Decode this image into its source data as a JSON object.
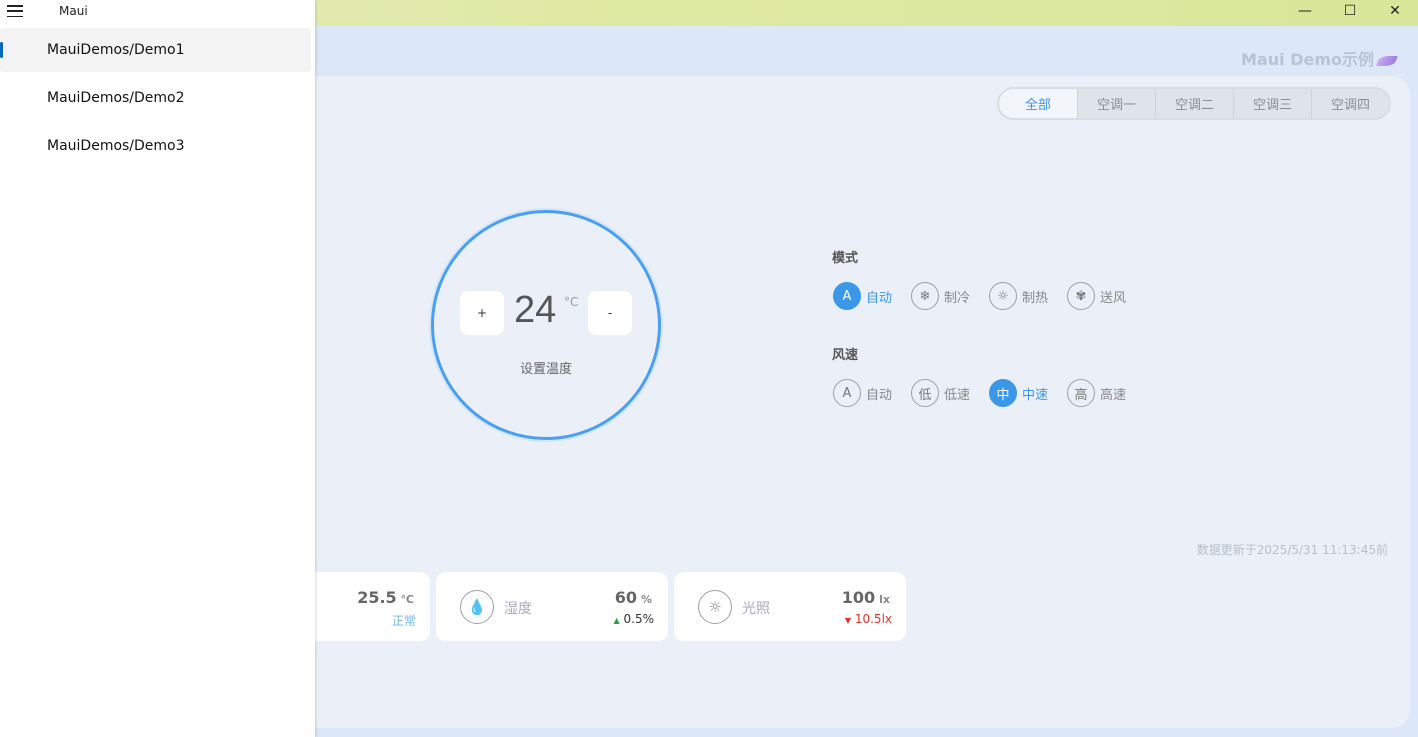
{
  "window": {
    "app_title": "Maui",
    "minimize": "—",
    "maximize": "☐",
    "close": "✕"
  },
  "nav": {
    "items": [
      {
        "label": "MauiDemos/Demo1",
        "selected": true
      },
      {
        "label": "MauiDemos/Demo2",
        "selected": false
      },
      {
        "label": "MauiDemos/Demo3",
        "selected": false
      }
    ]
  },
  "header": {
    "brand": "Maui Demo示例"
  },
  "tabs": [
    "全部",
    "空调一",
    "空调二",
    "空调三",
    "空调四"
  ],
  "thermostat": {
    "plus": "+",
    "minus": "-",
    "temperature": "24",
    "unit": "°C",
    "label": "设置温度"
  },
  "mode": {
    "title": "模式",
    "options": [
      {
        "icon": "A",
        "label": "自动",
        "active": true
      },
      {
        "icon": "❄",
        "label": "制冷",
        "active": false
      },
      {
        "icon": "☼",
        "label": "制热",
        "active": false
      },
      {
        "icon": "✾",
        "label": "送风",
        "active": false
      }
    ]
  },
  "fan": {
    "title": "风速",
    "options": [
      {
        "icon": "A",
        "label": "自动",
        "active": false
      },
      {
        "icon": "低",
        "label": "低速",
        "active": false
      },
      {
        "icon": "中",
        "label": "中速",
        "active": true
      },
      {
        "icon": "高",
        "label": "高速",
        "active": false
      }
    ]
  },
  "update_time": "数据更新于2025/5/31 11:13:45前",
  "sensors": [
    {
      "name": "",
      "value": "25.5",
      "unit": "℃",
      "delta": "正常",
      "status": "normal"
    },
    {
      "name": "湿度",
      "icon": "💧",
      "value": "60",
      "unit": "%",
      "delta": "0.5%",
      "arrow": "▲",
      "status": "up"
    },
    {
      "name": "光照",
      "icon": "☼",
      "value": "100",
      "unit": "lx",
      "delta": "10.5lx",
      "arrow": "▼",
      "status": "down"
    }
  ],
  "colors": {
    "accent": "#3b97e8",
    "titlebar": "#dfe9a3",
    "background": "#dce8f8",
    "card": "#ebf0f8"
  }
}
